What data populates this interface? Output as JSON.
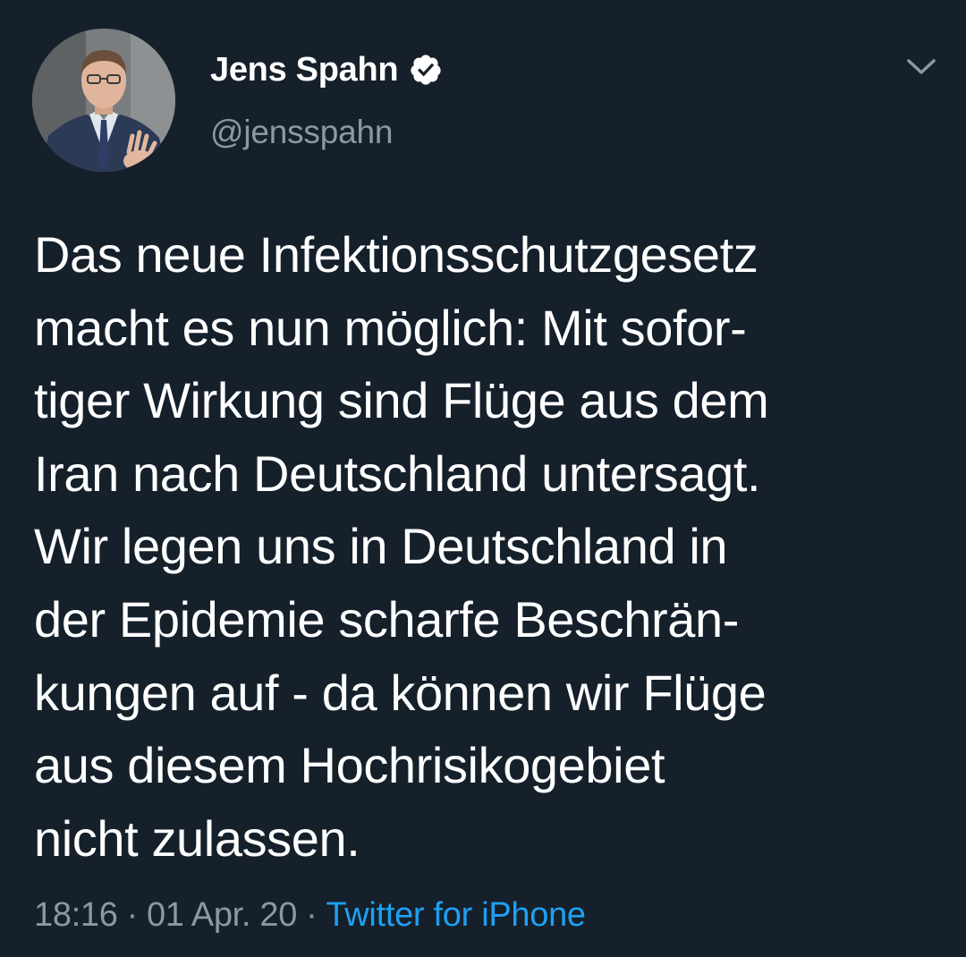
{
  "tweet": {
    "author": {
      "display_name": "Jens Spahn",
      "handle": "@jensspahn",
      "verified": true
    },
    "text_lines": [
      "Das neue Infektionsschutzgesetz",
      "macht es nun möglich: Mit sofor-",
      "tiger Wirkung sind Flüge aus dem",
      "Iran nach Deutschland untersagt.",
      "Wir legen uns in Deutschland in",
      "der Epidemie scharfe Beschrän-",
      "kungen auf - da können wir Flüge",
      "aus diesem Hochrisikogebiet",
      "nicht zulassen."
    ],
    "meta": {
      "time": "18:16",
      "date": "01 Apr. 20",
      "separator": "·",
      "source": "Twitter for iPhone"
    }
  },
  "icons": {
    "verified": "verified-badge-icon",
    "menu": "chevron-down-icon"
  },
  "colors": {
    "background": "#15202b",
    "text": "#ffffff",
    "secondary": "#8b98a5",
    "link": "#1da1f2"
  }
}
